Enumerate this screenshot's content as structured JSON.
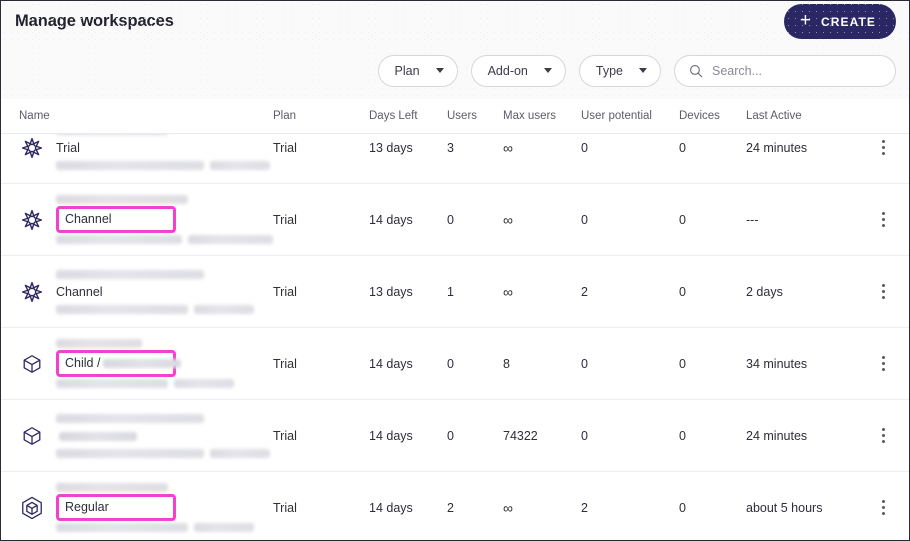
{
  "window": {
    "title": "Manage workspaces",
    "accent_navy": "#2b2764",
    "highlight_pink": "#f43fd0"
  },
  "header": {
    "title": "Manage workspaces",
    "create_button": {
      "label": "CREATE",
      "icon": "plus-icon",
      "glyph": "+"
    }
  },
  "toolbar": {
    "filters": [
      {
        "label": "Plan",
        "icon": "chevron-down-icon"
      },
      {
        "label": "Add-on",
        "icon": "chevron-down-icon"
      },
      {
        "label": "Type",
        "icon": "chevron-down-icon"
      }
    ],
    "search": {
      "icon": "search-icon",
      "placeholder": "Search...",
      "value": ""
    }
  },
  "table": {
    "columns": [
      "Name",
      "Plan",
      "Days Left",
      "Users",
      "Max users",
      "User potential",
      "Devices",
      "Last Active"
    ],
    "rows": [
      {
        "icon": "star-workspace-icon",
        "type_label": "Trial",
        "type_suffix": "",
        "highlighted": false,
        "redacted": true,
        "plan": "Trial",
        "days_left": "13 days",
        "users": "3",
        "max_users": "∞",
        "user_potential": "0",
        "devices": "0",
        "last_active": "24 minutes",
        "menu_icon": "kebab-menu-icon"
      },
      {
        "icon": "star-workspace-icon",
        "type_label": "Channel",
        "type_suffix": "",
        "highlighted": true,
        "plan": "Trial",
        "days_left": "14 days",
        "users": "0",
        "max_users": "∞",
        "user_potential": "0",
        "devices": "0",
        "last_active": "---",
        "menu_icon": "kebab-menu-icon"
      },
      {
        "icon": "star-workspace-icon",
        "type_label": "Channel",
        "type_suffix": "",
        "highlighted": false,
        "plan": "Trial",
        "days_left": "13 days",
        "users": "1",
        "max_users": "∞",
        "user_potential": "2",
        "devices": "0",
        "last_active": "2 days",
        "menu_icon": "kebab-menu-icon"
      },
      {
        "icon": "cube-workspace-icon",
        "type_label": "Child /",
        "type_suffix": "redacted",
        "highlighted": true,
        "plan": "Trial",
        "days_left": "14 days",
        "users": "0",
        "max_users": "8",
        "user_potential": "0",
        "devices": "0",
        "last_active": "34 minutes",
        "menu_icon": "kebab-menu-icon"
      },
      {
        "icon": "cube-workspace-icon",
        "type_label": "",
        "type_suffix": "redacted",
        "highlighted": false,
        "plan": "Trial",
        "days_left": "14 days",
        "users": "0",
        "max_users": "74322",
        "user_potential": "0",
        "devices": "0",
        "last_active": "24 minutes",
        "menu_icon": "kebab-menu-icon"
      },
      {
        "icon": "hex-cube-workspace-icon",
        "type_label": "Regular",
        "type_suffix": "",
        "highlighted": true,
        "plan": "Trial",
        "days_left": "14 days",
        "users": "2",
        "max_users": "∞",
        "user_potential": "2",
        "devices": "0",
        "last_active": "about 5 hours",
        "menu_icon": "kebab-menu-icon"
      }
    ]
  }
}
